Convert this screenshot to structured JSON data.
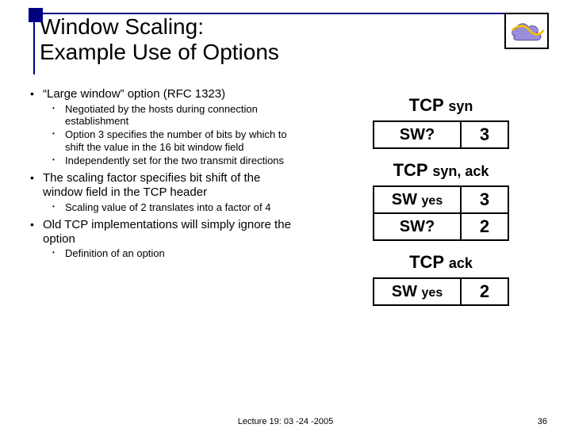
{
  "title": "Window Scaling:\nExample Use of Options",
  "bullets": [
    {
      "text": "“Large window” option (RFC 1323)",
      "sub": [
        "Negotiated by the hosts during connection establishment",
        "Option 3 specifies the number of bits by which to shift the value in the 16 bit window field",
        "Independently set for the two transmit directions"
      ]
    },
    {
      "text": "The scaling factor specifies bit shift of the window field in the TCP header",
      "sub": [
        "Scaling value of 2 translates into a factor of 4"
      ]
    },
    {
      "text": "Old TCP implementations will simply ignore the option",
      "sub": [
        "Definition of an option"
      ]
    }
  ],
  "right": {
    "blocks": [
      {
        "head_main": "TCP ",
        "head_sub": "syn",
        "rows": [
          {
            "l_main": "SW?",
            "l_sub": "",
            "r": "3"
          }
        ]
      },
      {
        "head_main": "TCP ",
        "head_sub": "syn, ack",
        "rows": [
          {
            "l_main": "SW ",
            "l_sub": "yes",
            "r": "3"
          },
          {
            "l_main": "SW?",
            "l_sub": "",
            "r": "2"
          }
        ]
      },
      {
        "head_main": "TCP ",
        "head_sub": "ack",
        "rows": [
          {
            "l_main": "SW ",
            "l_sub": "yes",
            "r": "2"
          }
        ]
      }
    ]
  },
  "footer": {
    "center": "Lecture 19: 03 -24 -2005",
    "right": "36"
  }
}
